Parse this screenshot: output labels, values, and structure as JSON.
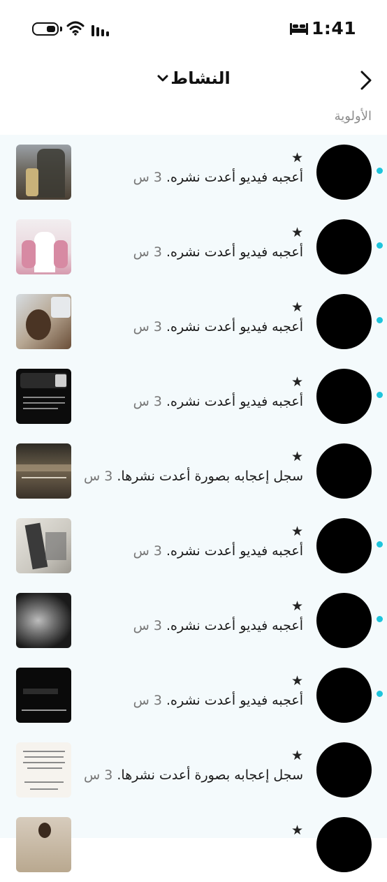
{
  "status_bar": {
    "time": "1:41"
  },
  "header": {
    "title": "النشاط"
  },
  "section": {
    "label": "الأولوية"
  },
  "rows": [
    {
      "star": "★",
      "text": "أعجبه فيديو أعدت نشره.",
      "time": "3 س"
    },
    {
      "star": "★",
      "text": "أعجبه فيديو أعدت نشره.",
      "time": "3 س"
    },
    {
      "star": "★",
      "text": "أعجبه فيديو أعدت نشره.",
      "time": "3 س"
    },
    {
      "star": "★",
      "text": "أعجبه فيديو أعدت نشره.",
      "time": "3 س"
    },
    {
      "star": "★",
      "text": "سجل إعجابه بصورة أعدت نشرها.",
      "time": "3 س"
    },
    {
      "star": "★",
      "text": "أعجبه فيديو أعدت نشره.",
      "time": "3 س"
    },
    {
      "star": "★",
      "text": "أعجبه فيديو أعدت نشره.",
      "time": "3 س"
    },
    {
      "star": "★",
      "text": "أعجبه فيديو أعدت نشره.",
      "time": "3 س"
    },
    {
      "star": "★",
      "text": "سجل إعجابه بصورة أعدت نشرها.",
      "time": "3 س"
    },
    {
      "star": "★",
      "text": "",
      "time": ""
    }
  ],
  "icons": {
    "battery": "battery-icon",
    "wifi": "wifi-icon",
    "signal": "signal-icon",
    "sleep": "bed-icon",
    "back": "chevron-right-icon",
    "title_dropdown": "chevron-down-icon"
  },
  "colors": {
    "unread_dot": "#1ec4dc",
    "list_background": "#f4fafc",
    "avatar": "#000000"
  }
}
